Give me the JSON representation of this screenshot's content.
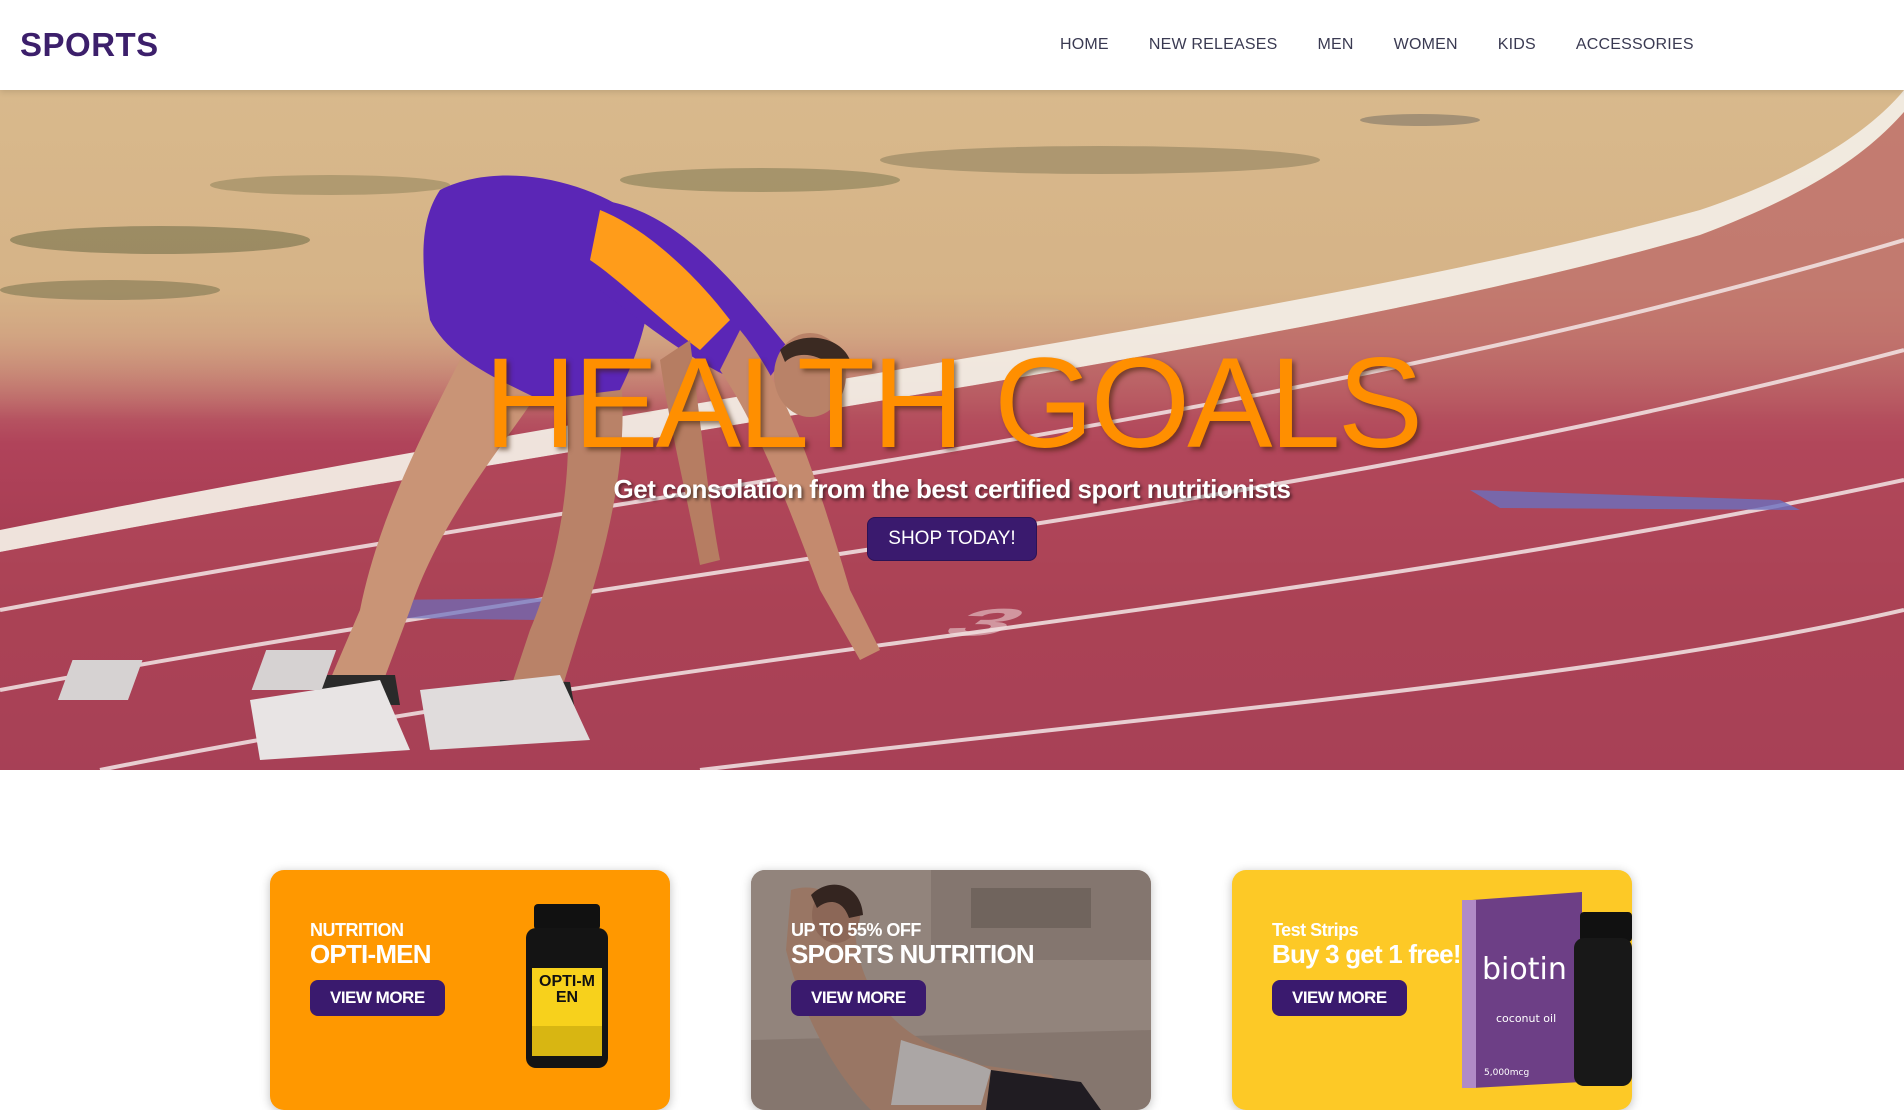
{
  "header": {
    "logo": "SPORTS",
    "nav": [
      "HOME",
      "NEW RELEASES",
      "MEN",
      "WOMEN",
      "KIDS",
      "ACCESSORIES"
    ]
  },
  "hero": {
    "title": "HEALTH GOALS",
    "subtitle": "Get consolation from the best certified sport nutritionists",
    "cta": "SHOP TODAY!",
    "lane_number": "3"
  },
  "cards": [
    {
      "kicker": "NUTRITION",
      "title": "OPTI-MEN",
      "button": "VIEW MORE",
      "bg": "#ff9800",
      "product_label": "OPTI-MEN"
    },
    {
      "kicker": "UP TO 55% OFF",
      "title": "SPORTS NUTRITION",
      "button": "VIEW MORE"
    },
    {
      "kicker": "Test Strips",
      "title": "Buy 3 get 1 free!",
      "button": "VIEW MORE",
      "bg": "#fdc926",
      "product_label": "biotin",
      "product_sub": "coconut oil",
      "product_strength": "5,000mcg"
    }
  ],
  "colors": {
    "brand": "#3c1f6b",
    "accent": "#ff8f00",
    "button": "#3a1a6e"
  }
}
